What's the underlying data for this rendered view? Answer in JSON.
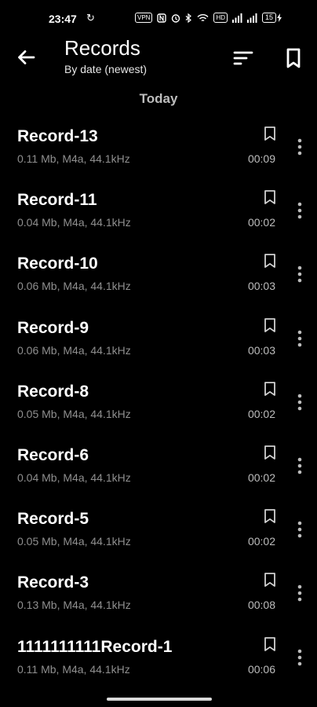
{
  "status_bar": {
    "time": "23:47",
    "sync_symbol": "↻",
    "vpn": "VPN",
    "hd": "HD",
    "battery": "15"
  },
  "header": {
    "title": "Records",
    "subtitle": "By date (newest)"
  },
  "section": "Today",
  "records": [
    {
      "name": "Record-13",
      "meta": "0.11 Mb, M4a, 44.1kHz",
      "duration": "00:09"
    },
    {
      "name": "Record-11",
      "meta": "0.04 Mb, M4a, 44.1kHz",
      "duration": "00:02"
    },
    {
      "name": "Record-10",
      "meta": "0.06 Mb, M4a, 44.1kHz",
      "duration": "00:03"
    },
    {
      "name": "Record-9",
      "meta": "0.06 Mb, M4a, 44.1kHz",
      "duration": "00:03"
    },
    {
      "name": "Record-8",
      "meta": "0.05 Mb, M4a, 44.1kHz",
      "duration": "00:02"
    },
    {
      "name": "Record-6",
      "meta": "0.04 Mb, M4a, 44.1kHz",
      "duration": "00:02"
    },
    {
      "name": "Record-5",
      "meta": "0.05 Mb, M4a, 44.1kHz",
      "duration": "00:02"
    },
    {
      "name": "Record-3",
      "meta": "0.13 Mb, M4a, 44.1kHz",
      "duration": "00:08"
    },
    {
      "name": "1111111111Record-1",
      "meta": "0.11 Mb, M4a, 44.1kHz",
      "duration": "00:06"
    }
  ],
  "colors": {
    "background": "#000000",
    "primary_text": "#ffffff",
    "secondary_text": "#8f8f8f"
  },
  "icons": {
    "back": "arrow-left-icon",
    "sort": "sort-icon",
    "bookmarks": "bookmark-icon",
    "row_bookmark": "bookmark-outline-icon",
    "row_more": "more-vertical-icon"
  }
}
